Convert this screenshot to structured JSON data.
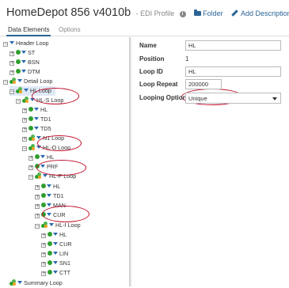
{
  "header": {
    "title": "HomeDepot 856 v4010b",
    "subtitle": "- EDI Profile",
    "folder_label": "Folder",
    "add_description_label": "Add Description"
  },
  "tabs": [
    "Data Elements",
    "Options"
  ],
  "tree": [
    {
      "label": "Header Loop",
      "kind": "text",
      "expanded": true
    },
    {
      "label": "ST",
      "kind": "seg"
    },
    {
      "label": "BSN",
      "kind": "seg"
    },
    {
      "label": "DTM",
      "kind": "seg"
    },
    {
      "label": "Detail Loop",
      "kind": "loop",
      "expanded": true
    },
    {
      "label": "HL Loop",
      "kind": "loop",
      "expanded": true,
      "selected": true
    },
    {
      "label": "HL-S Loop",
      "kind": "loop",
      "expanded": true
    },
    {
      "label": "HL",
      "kind": "seg"
    },
    {
      "label": "TD1",
      "kind": "seg"
    },
    {
      "label": "TD5",
      "kind": "seg"
    },
    {
      "label": "N1 Loop",
      "kind": "loop"
    },
    {
      "label": "HL-O Loop",
      "kind": "loop",
      "expanded": true
    },
    {
      "label": "HL",
      "kind": "seg"
    },
    {
      "label": "PRF",
      "kind": "seg"
    },
    {
      "label": "HL-P Loop",
      "kind": "loop",
      "expanded": true
    },
    {
      "label": "HL",
      "kind": "seg"
    },
    {
      "label": "TD1",
      "kind": "seg"
    },
    {
      "label": "MAN",
      "kind": "seg"
    },
    {
      "label": "CUR",
      "kind": "seg"
    },
    {
      "label": "HL-I Loop",
      "kind": "loop",
      "expanded": true
    },
    {
      "label": "HL",
      "kind": "seg"
    },
    {
      "label": "CUR",
      "kind": "seg"
    },
    {
      "label": "LIN",
      "kind": "seg"
    },
    {
      "label": "SN1",
      "kind": "seg"
    },
    {
      "label": "CTT",
      "kind": "seg"
    },
    {
      "label": "Summary Loop",
      "kind": "loop"
    }
  ],
  "form": {
    "name_label": "Name",
    "name_value": "HL",
    "position_label": "Position",
    "position_value": "1",
    "loop_id_label": "Loop ID",
    "loop_id_value": "HL",
    "loop_repeat_label": "Loop Repeat",
    "loop_repeat_value": "200000",
    "looping_option_label": "Looping Option",
    "looping_option_value": "Unique"
  },
  "colors": {
    "accent": "#2a6496",
    "annotation": "#c0102a",
    "segment_dot": "#2e9e2e"
  }
}
